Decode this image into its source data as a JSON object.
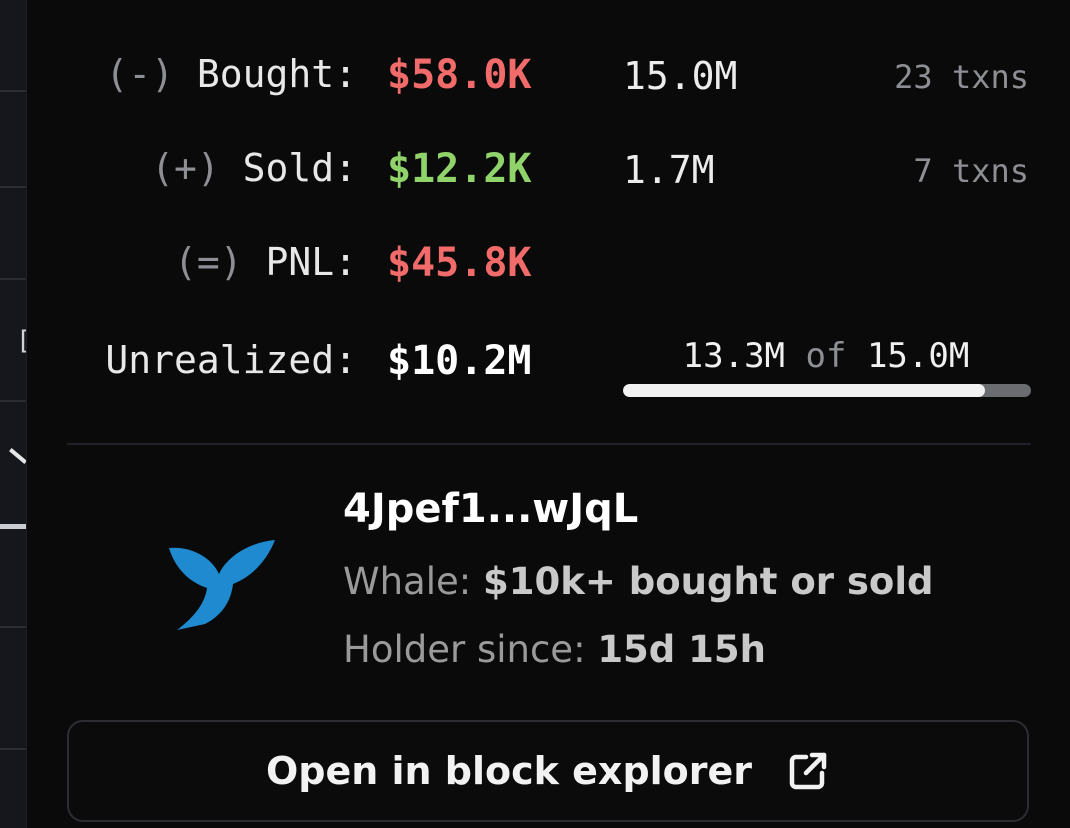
{
  "stats": {
    "bought": {
      "sign": "(-)",
      "label": "Bought:",
      "amount": "$58.0K",
      "quantity": "15.0M",
      "txns": "23 txns"
    },
    "sold": {
      "sign": "(+)",
      "label": "Sold:",
      "amount": "$12.2K",
      "quantity": "1.7M",
      "txns": "7 txns"
    },
    "pnl": {
      "sign": "(=)",
      "label": "PNL:",
      "amount": "$45.8K"
    },
    "unrealized": {
      "label": "Unrealized:",
      "amount": "$10.2M"
    }
  },
  "holding": {
    "held": "13.3M",
    "of_word": "of",
    "total": "15.0M",
    "fraction": 0.887
  },
  "wallet": {
    "address": "4Jpef1...wJqL",
    "type_label": "Whale:",
    "type_value": "$10k+ bought or sold",
    "since_label": "Holder since:",
    "since_value": "15d 15h",
    "icon": "whale-tail-icon"
  },
  "actions": {
    "explorer_label": "Open in block explorer",
    "explorer_icon": "external-link-icon"
  },
  "colors": {
    "loss": "#f16b6b",
    "gain": "#8fd36a",
    "whale": "#1f8ad0"
  }
}
